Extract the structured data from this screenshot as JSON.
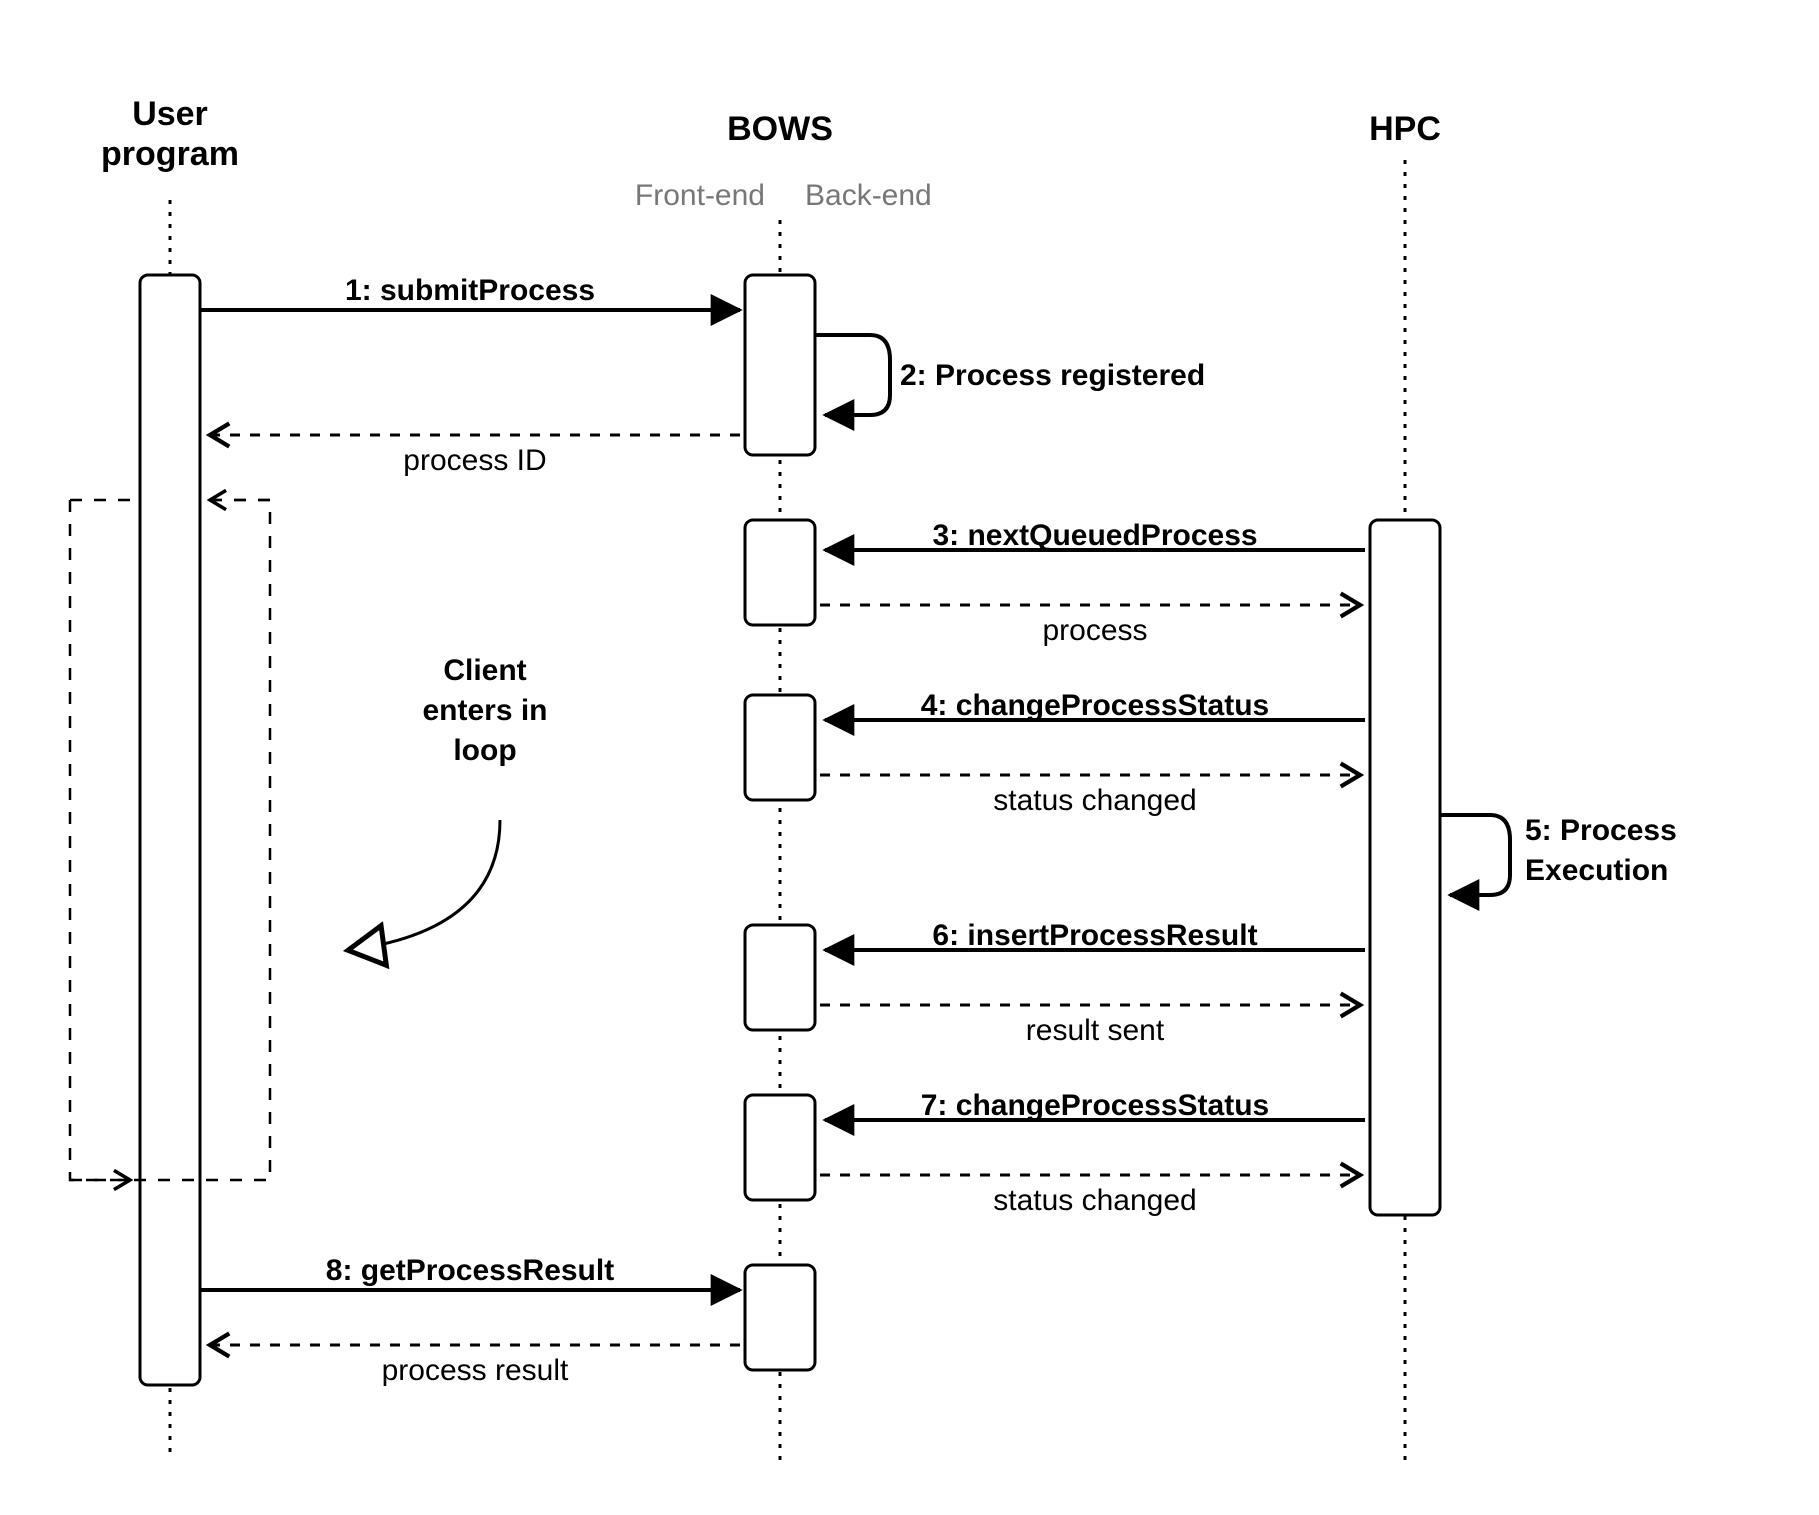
{
  "participants": {
    "user": {
      "title1": "User",
      "title2": "program"
    },
    "bows": {
      "title": "BOWS",
      "front": "Front-end",
      "back": "Back-end"
    },
    "hpc": {
      "title": "HPC"
    }
  },
  "annotation": {
    "line1": "Client",
    "line2": "enters in",
    "line3": "loop"
  },
  "messages": {
    "m1": "1: submitProcess",
    "m1r": "process ID",
    "m2": "2: Process registered",
    "m3": "3: nextQueuedProcess",
    "m3r": "process",
    "m4": "4: changeProcessStatus",
    "m4r": "status changed",
    "m5a": "5: Process",
    "m5b": "Execution",
    "m6": "6: insertProcessResult",
    "m6r": "result sent",
    "m7": "7: changeProcessStatus",
    "m7r": "status changed",
    "m8": "8: getProcessResult",
    "m8r": "process result"
  }
}
